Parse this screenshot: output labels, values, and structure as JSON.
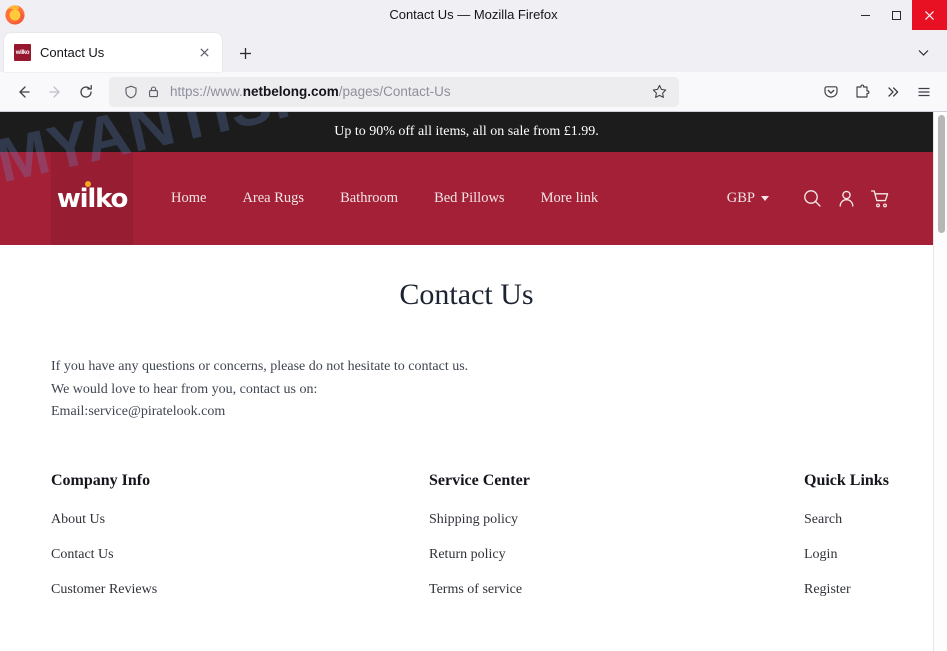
{
  "browser": {
    "window_title": "Contact Us — Mozilla Firefox",
    "minimize_label": "—",
    "maximize_label": "□",
    "close_label": "✕",
    "tab": {
      "title": "Contact Us",
      "favicon_mark": "wilko",
      "close_label": "✕"
    },
    "new_tab_label": "+",
    "tab_list_label": "⌄",
    "nav": {
      "back": "←",
      "forward": "→",
      "reload": "⟳"
    },
    "url": {
      "prefix": "https://www.",
      "host": "netbelong.com",
      "path": "/pages/Contact-Us",
      "full": "https://www.netbelong.com/pages/Contact-Us"
    },
    "toolbar": {
      "bookmark_star": "☆",
      "pocket": "pocket-icon",
      "extensions": "extensions-icon",
      "overflow": "»",
      "app_menu": "≡"
    }
  },
  "site": {
    "announcement": "Up to 90% off all items, all on sale from £1.99.",
    "logo_text": "wilko",
    "nav_links": [
      "Home",
      "Area Rugs",
      "Bathroom",
      "Bed Pillows",
      "More link"
    ],
    "currency": "GBP",
    "header_icons": [
      "search-icon",
      "account-icon",
      "cart-icon"
    ],
    "colors": {
      "header_red": "#a32036",
      "announce_black": "#1c1c1c",
      "logo_dot_orange": "#f5a623",
      "watermark_blue": "#6c8bd1"
    }
  },
  "main": {
    "title": "Contact Us",
    "lines": [
      "If you have any questions or concerns, please do not hesitate to contact us.",
      "We would love to hear from you, contact us on:",
      "Email:service@piratelook.com"
    ],
    "email": "service@piratelook.com"
  },
  "footer": {
    "columns": [
      {
        "heading": "Company Info",
        "links": [
          "About Us",
          "Contact Us",
          "Customer Reviews"
        ]
      },
      {
        "heading": "Service Center",
        "links": [
          "Shipping policy",
          "Return policy",
          "Terms of service"
        ]
      },
      {
        "heading": "Quick Links",
        "links": [
          "Search",
          "Login",
          "Register"
        ]
      }
    ]
  },
  "watermark": {
    "text": "MYANTISPYWARE.COM"
  }
}
